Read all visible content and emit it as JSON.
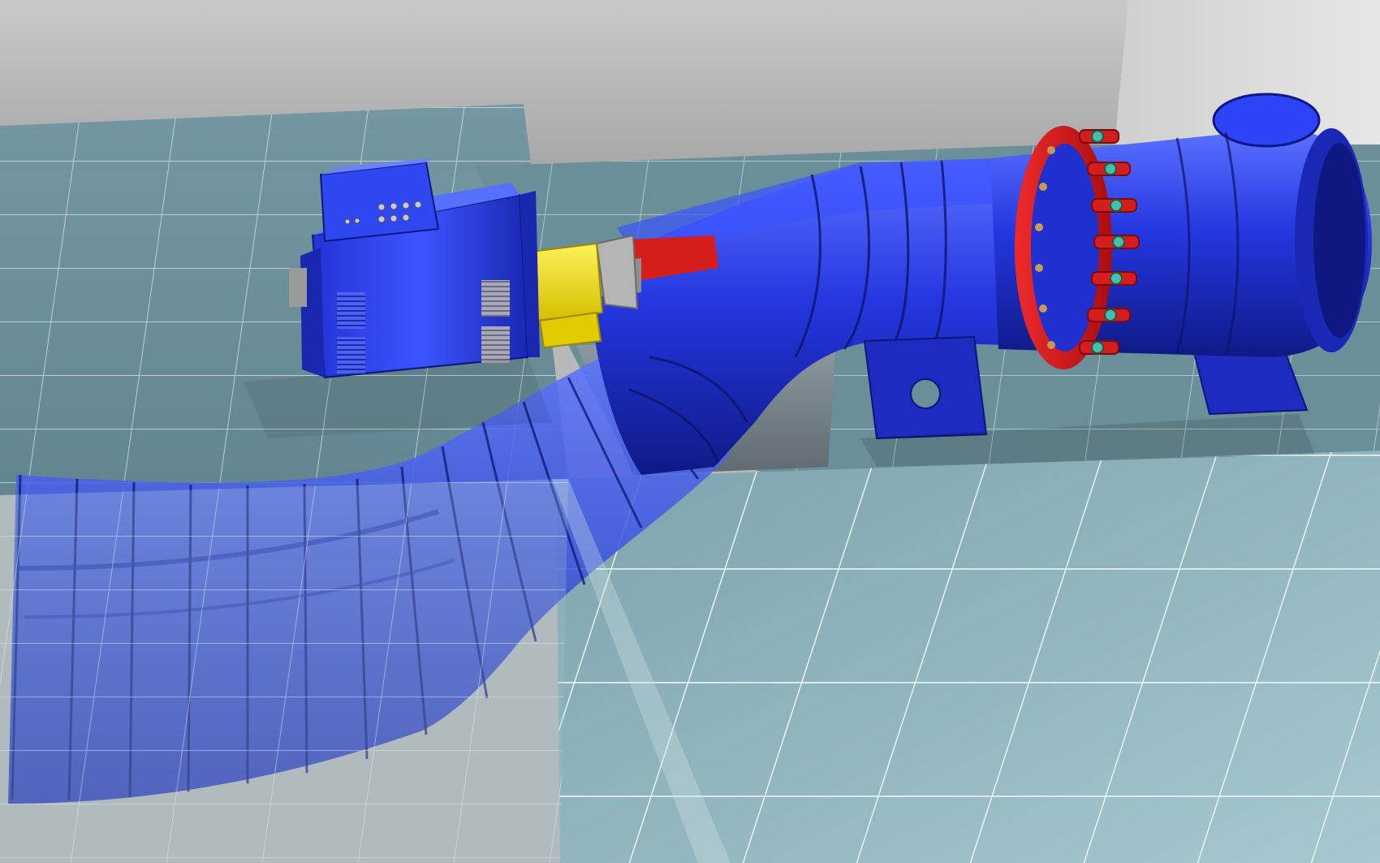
{
  "scene": {
    "colors": {
      "back_wall": "#b8b8b8",
      "side_wall": "#d6d6d6",
      "floor_tile": "#8fb3bb",
      "tile_grout": "#e8f2f4",
      "machine_blue": "#2233d6",
      "machine_blue_light": "#4d66ff",
      "machine_blue_dark": "#101c8a",
      "coupling_yellow": "#f2dc00",
      "guide_vane_red": "#d3181c",
      "shaft_grey": "#9a9a9a"
    },
    "icons": [
      "generator-icon",
      "coupling-icon",
      "draft-tube-icon",
      "turbine-casing-icon",
      "guide-vane-ring-icon",
      "inlet-pipe-icon",
      "support-frame-icon"
    ]
  }
}
